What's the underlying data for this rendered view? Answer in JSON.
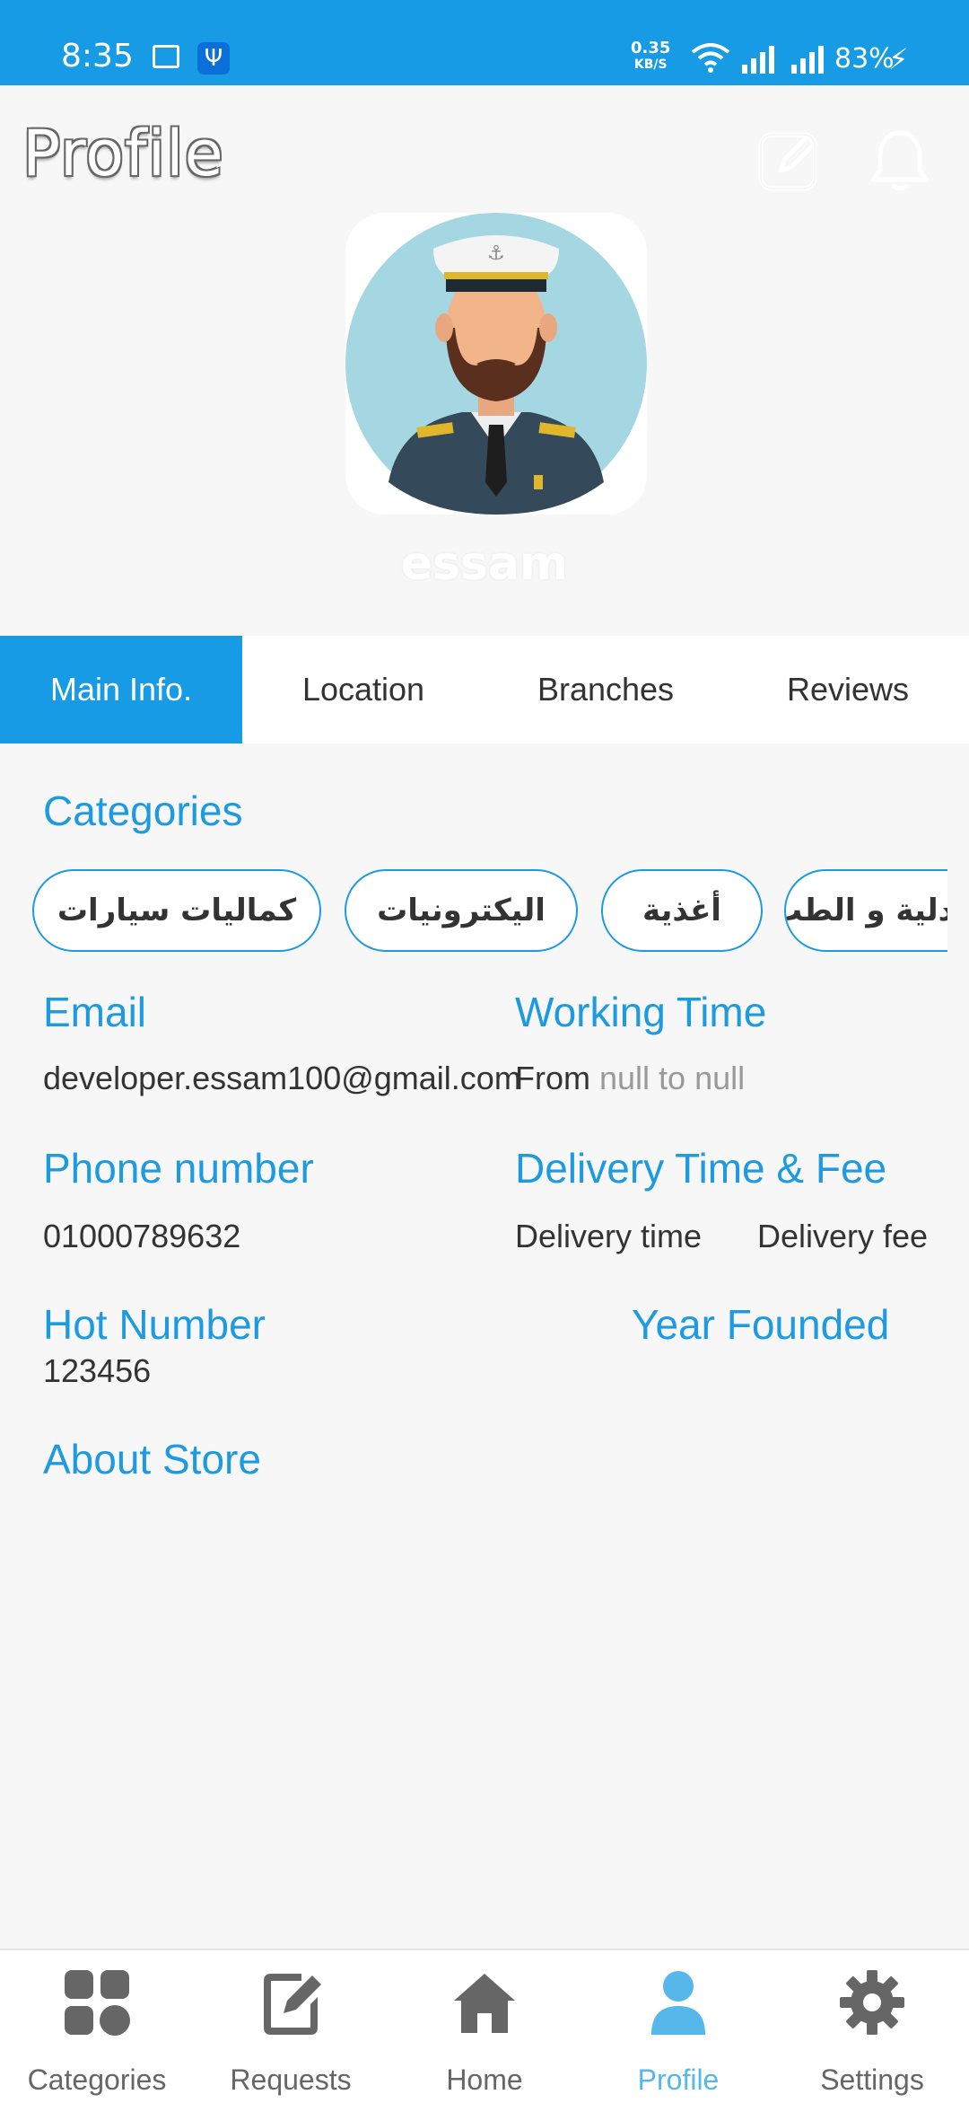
{
  "status_bar": {
    "time": "8:35",
    "speed_value": "0.35",
    "speed_unit": "KB/S",
    "battery": "83%"
  },
  "header": {
    "title": "Profile",
    "edit_icon": "edit-icon",
    "bell_icon": "bell-icon"
  },
  "profile": {
    "username": "essam"
  },
  "tabs": [
    {
      "label": "Main Info.",
      "active": true
    },
    {
      "label": "Location",
      "active": false
    },
    {
      "label": "Branches",
      "active": false
    },
    {
      "label": "Reviews",
      "active": false
    }
  ],
  "main": {
    "categories_label": "Categories",
    "categories": [
      "كماليات سيارات",
      "اليكترونيات",
      "أغذية",
      "صيدلية و الطب"
    ],
    "email_label": "Email",
    "email_value": "developer.essam100@gmail.com",
    "working_time_label": "Working Time",
    "working_time_prefix": "From",
    "working_time_value": "null to null",
    "phone_label": "Phone number",
    "phone_value": "01000789632",
    "delivery_label": "Delivery Time & Fee",
    "delivery_time": "Delivery time",
    "delivery_fee": "Delivery fee",
    "hot_number_label": "Hot Number",
    "hot_number_value": "123456",
    "year_founded_label": "Year Founded",
    "about_label": "About Store"
  },
  "bottom_nav": [
    {
      "label": "Categories",
      "icon": "categories-icon",
      "active": false
    },
    {
      "label": "Requests",
      "icon": "requests-icon",
      "active": false
    },
    {
      "label": "Home",
      "icon": "home-icon",
      "active": false
    },
    {
      "label": "Profile",
      "icon": "profile-icon",
      "active": true
    },
    {
      "label": "Settings",
      "icon": "settings-icon",
      "active": false
    }
  ],
  "colors": {
    "accent": "#169be4",
    "label_blue": "#1e9ae0",
    "nav_active": "#56b8ea",
    "background": "#f7f7f7"
  }
}
